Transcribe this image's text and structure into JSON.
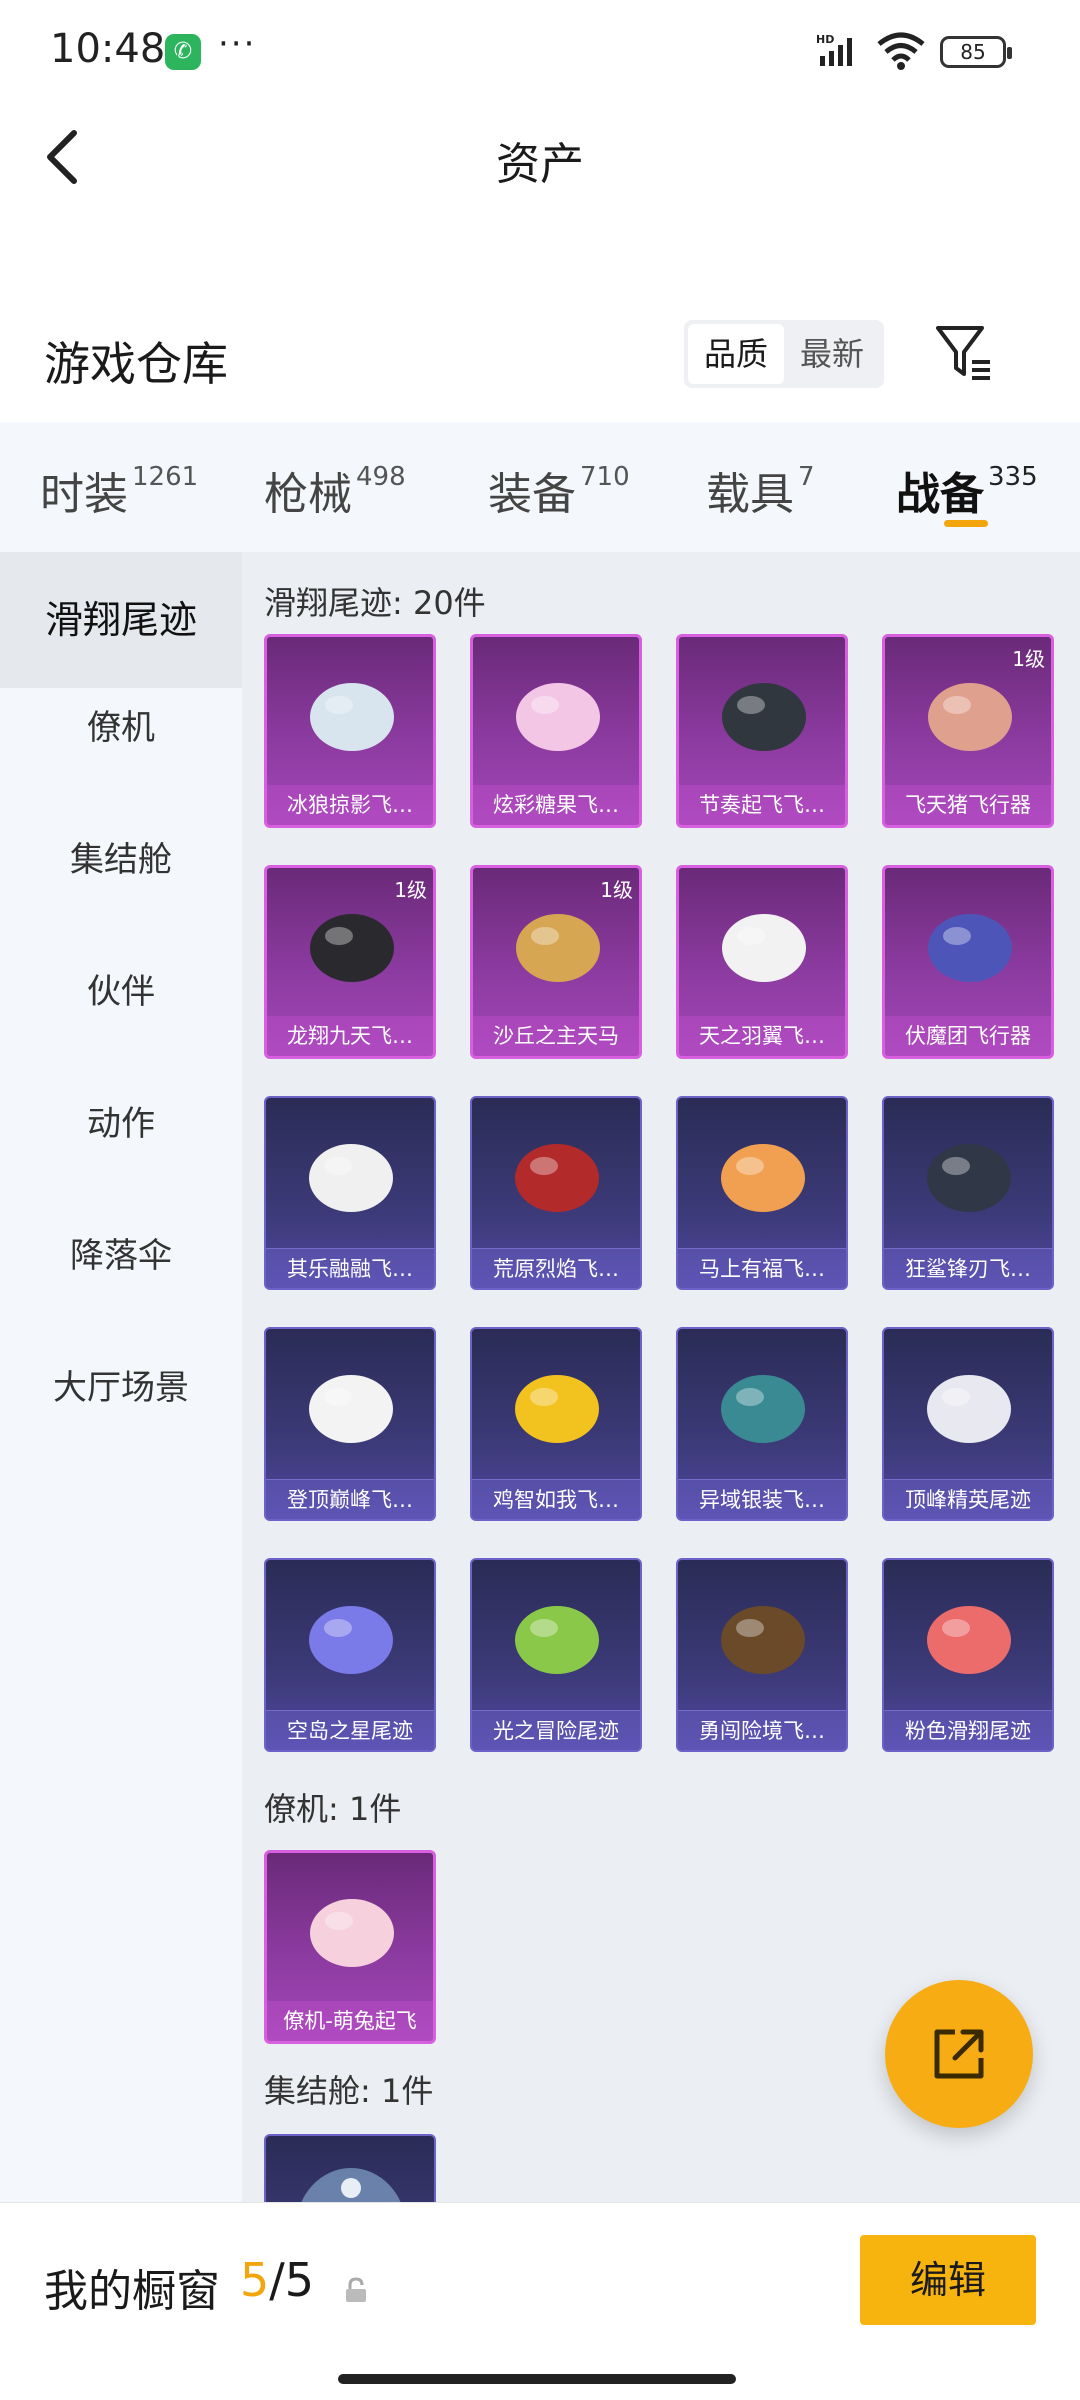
{
  "status": {
    "time": "10:48",
    "network": "HD",
    "battery": "85"
  },
  "header": {
    "title": "资产"
  },
  "warehouse": {
    "title": "游戏仓库",
    "sort_options": [
      "品质",
      "最新"
    ]
  },
  "tabs": [
    {
      "label": "时装",
      "count": "1261"
    },
    {
      "label": "枪械",
      "count": "498"
    },
    {
      "label": "装备",
      "count": "710"
    },
    {
      "label": "载具",
      "count": "7"
    },
    {
      "label": "战备",
      "count": "335"
    }
  ],
  "sidebar": {
    "items": [
      "滑翔尾迹",
      "僚机",
      "集结舱",
      "伙伴",
      "动作",
      "降落伞",
      "大厅场景"
    ]
  },
  "sections": {
    "glide": {
      "label": "滑翔尾迹: 20件",
      "items": [
        {
          "name": "冰狼掠影飞…",
          "level": "",
          "style": "pink",
          "icon": "ice-streak-icon"
        },
        {
          "name": "炫彩糖果飞…",
          "level": "",
          "style": "pink",
          "icon": "candy-icon"
        },
        {
          "name": "节奏起飞飞…",
          "level": "",
          "style": "pink",
          "icon": "helmet-icon"
        },
        {
          "name": "飞天猪飞行器",
          "level": "1级",
          "style": "pink",
          "icon": "pig-icon"
        },
        {
          "name": "龙翔九天飞…",
          "level": "1级",
          "style": "pink",
          "icon": "dragon-icon"
        },
        {
          "name": "沙丘之主天马",
          "level": "1级",
          "style": "pink",
          "icon": "pegasus-icon"
        },
        {
          "name": "天之羽翼飞…",
          "level": "",
          "style": "pink",
          "icon": "wing-icon"
        },
        {
          "name": "伏魔团飞行器",
          "level": "",
          "style": "pink",
          "icon": "sword-glider-icon"
        },
        {
          "name": "其乐融融飞…",
          "level": "",
          "style": "purple",
          "icon": "penguin-icon"
        },
        {
          "name": "荒原烈焰飞…",
          "level": "",
          "style": "purple",
          "icon": "flame-glider-icon"
        },
        {
          "name": "马上有福飞…",
          "level": "",
          "style": "purple",
          "icon": "horse-icon"
        },
        {
          "name": "狂鲨锋刃飞…",
          "level": "",
          "style": "purple",
          "icon": "shark-icon"
        },
        {
          "name": "登顶巅峰飞…",
          "level": "",
          "style": "purple",
          "icon": "jet-icon"
        },
        {
          "name": "鸡智如我飞…",
          "level": "",
          "style": "purple",
          "icon": "chicken-icon"
        },
        {
          "name": "异域银装飞…",
          "level": "",
          "style": "purple",
          "icon": "alien-glider-icon"
        },
        {
          "name": "顶峰精英尾迹",
          "level": "",
          "style": "purple",
          "icon": "smoke-trail-icon"
        },
        {
          "name": "空岛之星尾迹",
          "level": "",
          "style": "purple",
          "icon": "rainbow-trail-icon"
        },
        {
          "name": "光之冒险尾迹",
          "level": "",
          "style": "purple",
          "icon": "green-trail-icon"
        },
        {
          "name": "勇闯险境飞…",
          "level": "",
          "style": "purple",
          "icon": "rocket-glider-icon"
        },
        {
          "name": "粉色滑翔尾迹",
          "level": "",
          "style": "purple",
          "icon": "pink-trail-icon"
        }
      ]
    },
    "wingman": {
      "label": "僚机: 1件",
      "items": [
        {
          "name": "僚机-萌兔起飞",
          "level": "",
          "style": "pink",
          "icon": "bunny-icon"
        }
      ]
    },
    "pod": {
      "label": "集结舱: 1件"
    }
  },
  "showcase": {
    "label": "我的橱窗",
    "current": "5",
    "total": "/5",
    "edit_label": "编辑"
  },
  "colors": {
    "accent": "#f2a60c",
    "edit_button": "#f8b40e",
    "pink_card": "#a347b8",
    "purple_card": "#3c3a78"
  }
}
